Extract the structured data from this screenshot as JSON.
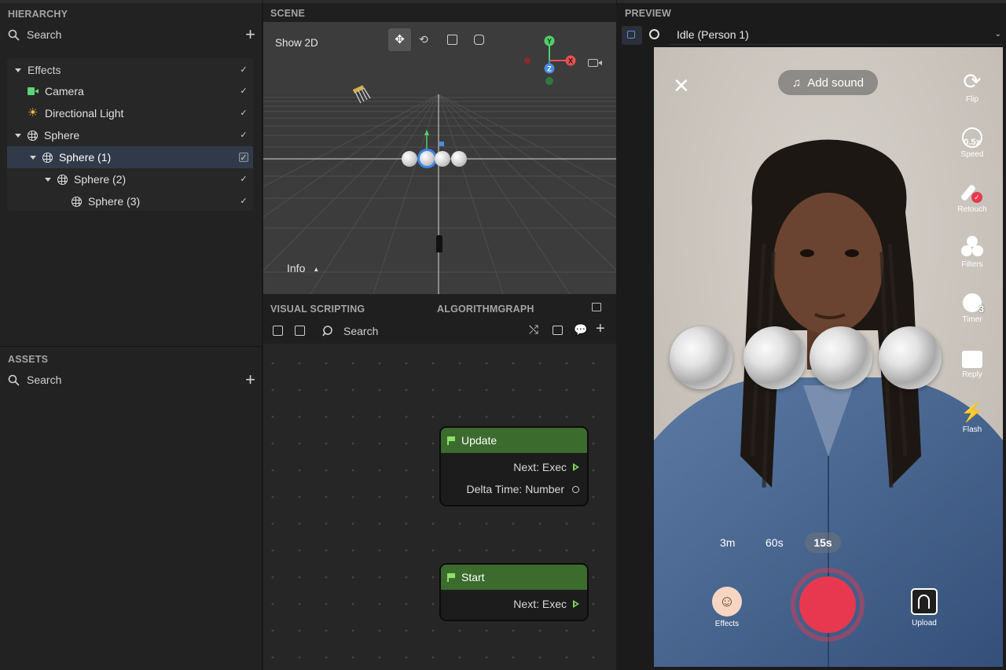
{
  "hierarchy": {
    "title": "HIERARCHY",
    "search_label": "Search",
    "items": [
      {
        "label": "Effects",
        "checked": true
      },
      {
        "label": "Camera",
        "checked": true
      },
      {
        "label": "Directional Light",
        "checked": true
      },
      {
        "label": "Sphere",
        "checked": true
      },
      {
        "label": "Sphere (1)",
        "checked": true,
        "selected": true
      },
      {
        "label": "Sphere (2)",
        "checked": true
      },
      {
        "label": "Sphere (3)",
        "checked": true
      }
    ]
  },
  "assets": {
    "title": "ASSETS",
    "search_label": "Search"
  },
  "scene": {
    "title": "SCENE",
    "show2d_label": "Show 2D",
    "info_label": "Info",
    "gizmo": {
      "y": "Y",
      "x": "X",
      "z": "Z"
    }
  },
  "visual_scripting": {
    "tab1": "VISUAL SCRIPTING",
    "tab2": "ALGORITHMGRAPH",
    "search_label": "Search",
    "nodes": [
      {
        "title": "Update",
        "pins": [
          "Next: Exec",
          "Delta Time: Number"
        ]
      },
      {
        "title": "Start",
        "pins": [
          "Next: Exec"
        ]
      }
    ]
  },
  "preview": {
    "title": "PREVIEW",
    "selected_animation": "Idle (Person 1)",
    "add_sound_label": "Add sound",
    "side_buttons": [
      {
        "label": "Flip",
        "icon": "flip-icon"
      },
      {
        "label": "Speed",
        "icon": "speed-icon",
        "badge": "0.5x"
      },
      {
        "label": "Retouch",
        "icon": "retouch-icon"
      },
      {
        "label": "Filters",
        "icon": "filters-icon"
      },
      {
        "label": "Timer",
        "icon": "timer-icon",
        "badge": "3"
      },
      {
        "label": "Reply",
        "icon": "reply-icon"
      },
      {
        "label": "Flash",
        "icon": "flash-icon"
      }
    ],
    "durations": [
      "3m",
      "60s",
      "15s"
    ],
    "selected_duration": "15s",
    "effects_label": "Effects",
    "upload_label": "Upload",
    "record_color": "#e8384f"
  }
}
